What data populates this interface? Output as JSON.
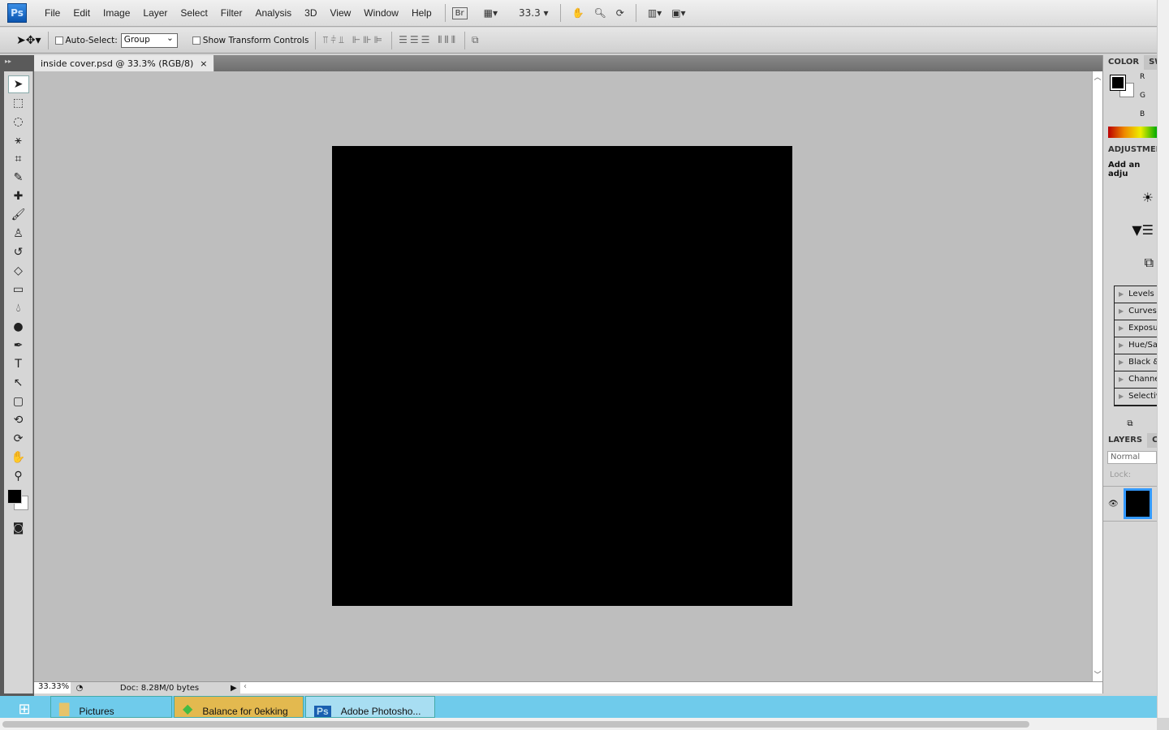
{
  "app": {
    "logo": "Ps",
    "menu": [
      "File",
      "Edit",
      "Image",
      "Layer",
      "Select",
      "Filter",
      "Analysis",
      "3D",
      "View",
      "Window",
      "Help"
    ],
    "bridge": "Br",
    "zoom": "33.3"
  },
  "options": {
    "auto_select_label": "Auto-Select:",
    "auto_select_checked": false,
    "auto_select_value": "Group",
    "show_transform_label": "Show Transform Controls",
    "show_transform_checked": false
  },
  "document": {
    "tab_title": "inside cover.psd @ 33.3% (RGB/8)",
    "close": "×",
    "fill_color": "#000000"
  },
  "tools": [
    "move-tool",
    "marquee-tool",
    "lasso-tool",
    "magic-wand-tool",
    "crop-tool",
    "eyedropper-tool",
    "healing-brush-tool",
    "brush-tool",
    "clone-stamp-tool",
    "history-brush-tool",
    "eraser-tool",
    "gradient-tool",
    "blur-tool",
    "dodge-tool",
    "pen-tool",
    "type-tool",
    "path-selection-tool",
    "shape-tool",
    "3d-rotate-tool",
    "3d-orbit-tool",
    "hand-tool",
    "zoom-tool"
  ],
  "status": {
    "zoom": "33.33%",
    "doc": "Doc: 8.28M/0 bytes"
  },
  "panels": {
    "color": {
      "tab": "COLOR",
      "tab2": "SW",
      "channels": [
        "R",
        "G",
        "B"
      ],
      "foreground": "#000000",
      "background": "#ffffff"
    },
    "adjustments": {
      "title": "ADJUSTMEN",
      "subtitle": "Add an adju",
      "presets": [
        "Levels P",
        "Curves",
        "Exposu",
        "Hue/Sa",
        "Black &",
        "Channe",
        "Selectiv"
      ]
    },
    "layers": {
      "tab": "LAYERS",
      "tab2": "CH",
      "blend": "Normal",
      "lock": "Lock:"
    }
  },
  "taskbar": {
    "items": [
      "Pictures",
      "Balance for 0ekking",
      "Adobe Photosho..."
    ],
    "colors": {
      "bar": "#6fcbeb",
      "active": "#e3b94f"
    }
  }
}
